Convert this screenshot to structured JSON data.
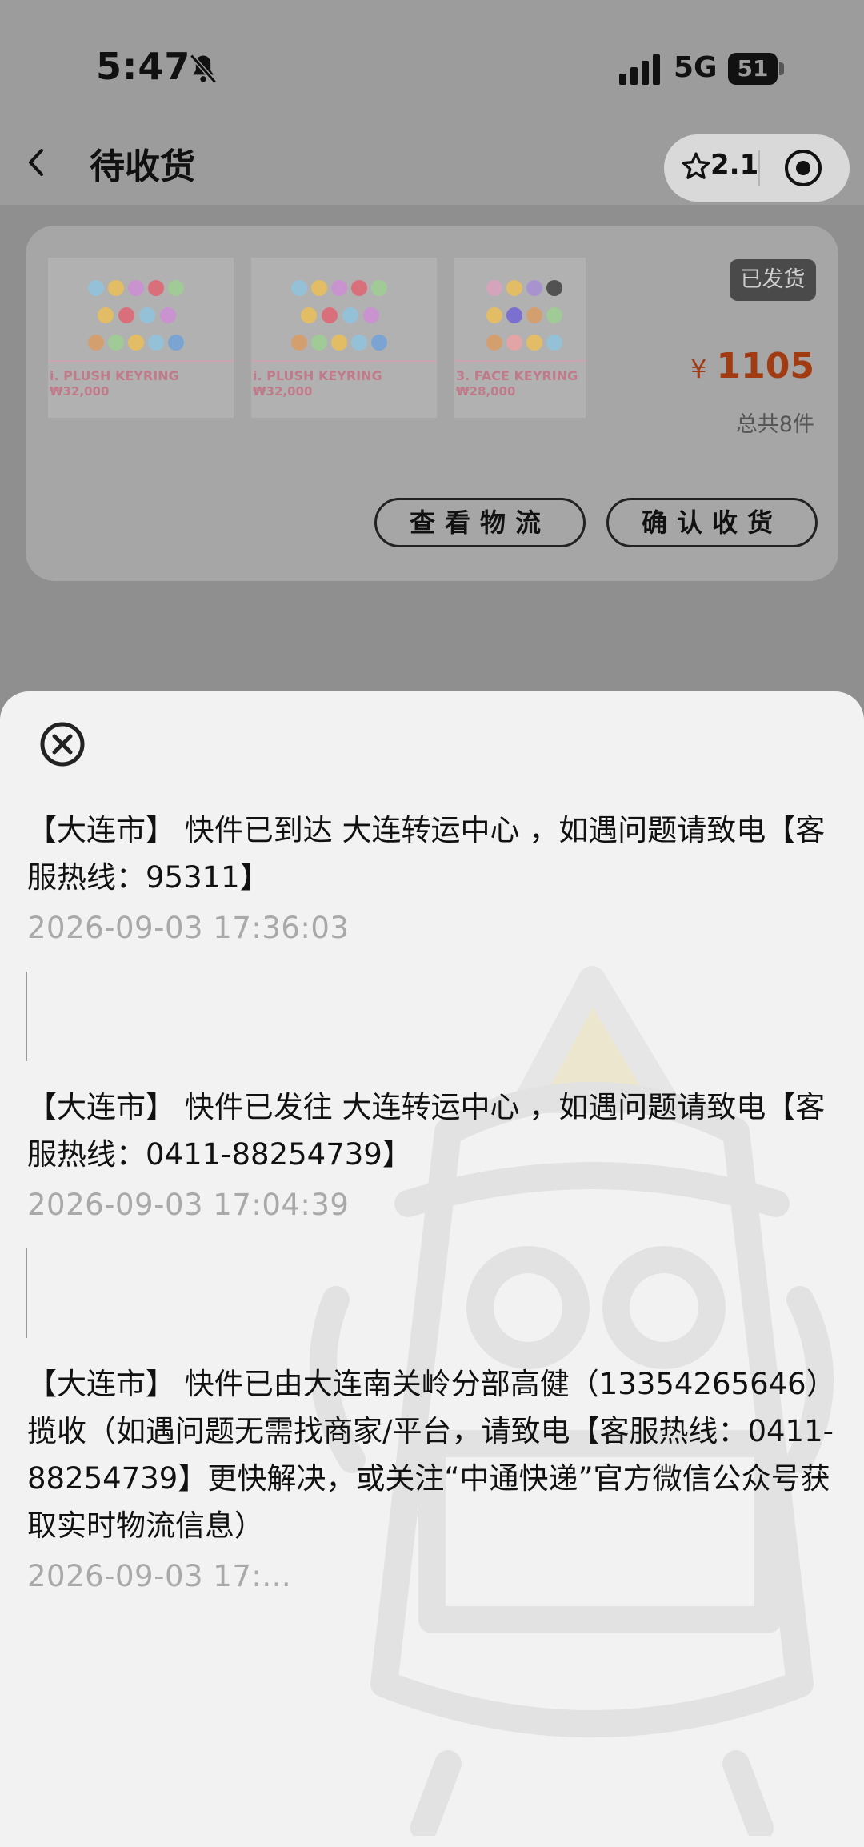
{
  "status_bar": {
    "time": "5:47",
    "network": "5G",
    "battery": "51"
  },
  "nav": {
    "title": "待收货",
    "mini_program_score": "2.1"
  },
  "order": {
    "products": [
      {
        "name": "i. PLUSH KEYRING",
        "price": "₩32,000"
      },
      {
        "name": "i. PLUSH KEYRING",
        "price": "₩32,000"
      },
      {
        "name": "3. FACE KEYRING",
        "price": "₩28,000"
      }
    ],
    "status_badge": "已发货",
    "currency_symbol": "¥",
    "total_amount": "1105",
    "item_count_text": "总共8件",
    "view_logistics_label": "查看物流",
    "confirm_receipt_label": "确认收货"
  },
  "logistics": {
    "entries": [
      {
        "message": "【大连市】 快件已到达 大连转运中心 ，如遇问题请致电【客服热线：95311】",
        "time": "2026-09-03 17:36:03"
      },
      {
        "message": "【大连市】 快件已发往 大连转运中心 ，如遇问题请致电【客服热线：0411-88254739】",
        "time": "2026-09-03 17:04:39"
      },
      {
        "message": "【大连市】 快件已由大连南关岭分部高健（13354265646）揽收（如遇问题无需找商家/平台，请致电【客服热线：0411-88254739】更快解决，或关注“中通快递”官方微信公众号获取实时物流信息）",
        "time": "2026-09-03 17:..."
      }
    ]
  },
  "colors": {
    "accent_price": "#a13b12",
    "overlay": "#9a9a9a",
    "sheet_bg": "#f2f2f2",
    "timestamp": "#a9a9a9"
  }
}
